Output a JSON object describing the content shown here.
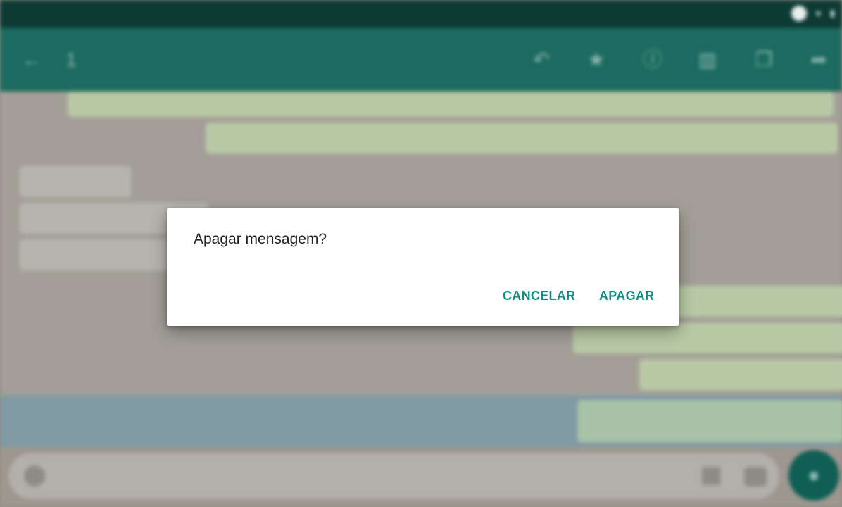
{
  "dialog": {
    "title": "Apagar mensagem?",
    "cancel_label": "CANCELAR",
    "confirm_label": "APAGAR"
  },
  "colors": {
    "accent": "#128c7e",
    "toolbar": "#1c6b60",
    "statusbar": "#0d3a33"
  },
  "icons": {
    "toolbar": [
      "back-arrow-icon",
      "reply-icon",
      "star-icon",
      "info-icon",
      "delete-icon",
      "copy-icon",
      "forward-icon"
    ],
    "inputbar": [
      "emoji-icon",
      "attach-icon",
      "camera-icon",
      "mic-icon"
    ]
  }
}
